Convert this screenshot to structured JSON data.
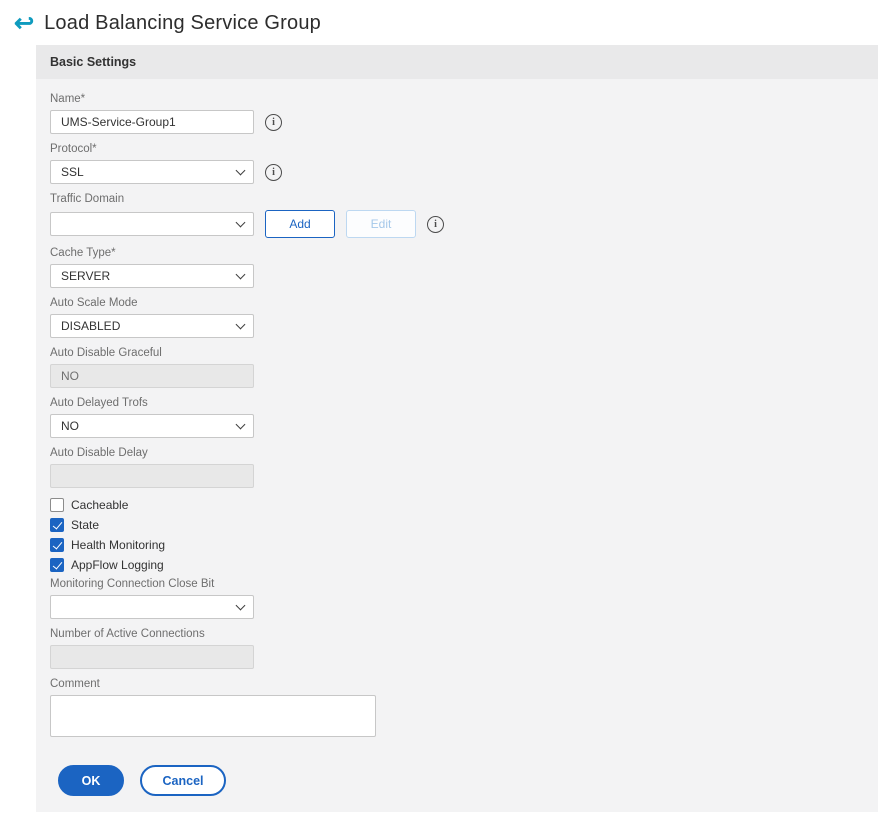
{
  "colors": {
    "accent": "#1b64c2",
    "back-arrow": "#0f9bbe",
    "panel-bg": "#f3f3f4",
    "panel-header-bg": "#e9e9ea",
    "disabled-bg": "#e8e8e8"
  },
  "icons": {
    "back_glyph": "↩",
    "info_glyph": "i"
  },
  "page": {
    "title": "Load Balancing Service Group"
  },
  "panel": {
    "header": "Basic Settings"
  },
  "fields": {
    "name": {
      "label": "Name*",
      "value": "UMS-Service-Group1"
    },
    "protocol": {
      "label": "Protocol*",
      "value": "SSL"
    },
    "traffic_domain": {
      "label": "Traffic Domain",
      "value": "",
      "add": "Add",
      "edit": "Edit"
    },
    "cache_type": {
      "label": "Cache Type*",
      "value": "SERVER"
    },
    "auto_scale_mode": {
      "label": "Auto Scale Mode",
      "value": "DISABLED"
    },
    "auto_disable_graceful": {
      "label": "Auto Disable Graceful",
      "value": "NO"
    },
    "auto_delayed_trofs": {
      "label": "Auto Delayed Trofs",
      "value": "NO"
    },
    "auto_disable_delay": {
      "label": "Auto Disable Delay",
      "value": ""
    },
    "monitoring_connection_close_bit": {
      "label": "Monitoring Connection Close Bit",
      "value": ""
    },
    "number_of_active_connections": {
      "label": "Number of Active Connections",
      "value": ""
    },
    "comment": {
      "label": "Comment",
      "value": ""
    }
  },
  "checkboxes": [
    {
      "label": "Cacheable",
      "checked": false
    },
    {
      "label": "State",
      "checked": true
    },
    {
      "label": "Health Monitoring",
      "checked": true
    },
    {
      "label": "AppFlow Logging",
      "checked": true
    }
  ],
  "actions": {
    "ok": "OK",
    "cancel": "Cancel"
  }
}
